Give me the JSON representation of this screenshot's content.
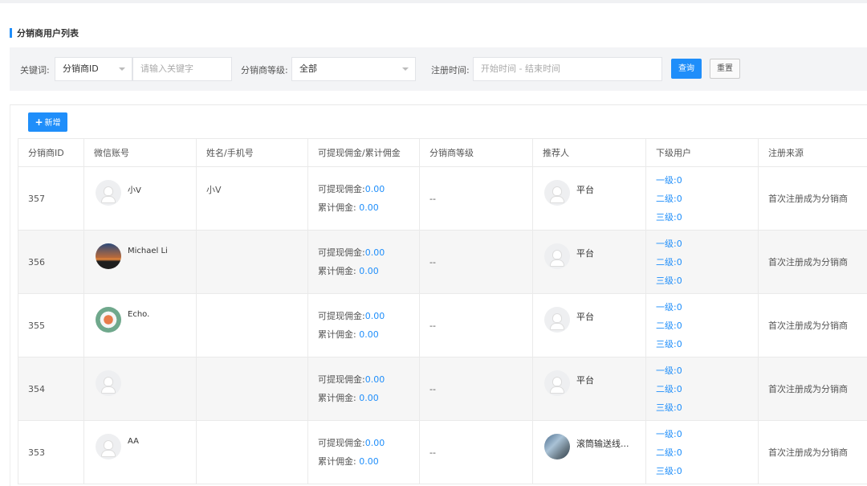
{
  "page": {
    "title": "分销商用户列表"
  },
  "filter": {
    "keyword_label": "关键词:",
    "keyword_type": "分销商ID",
    "keyword_placeholder": "请输入关键字",
    "level_label": "分销商等级:",
    "level_value": "全部",
    "time_label": "注册时间:",
    "time_placeholder": "开始时间 - 结束时间",
    "query_label": "查询",
    "reset_label": "重置"
  },
  "toolbar": {
    "add_label": "新增",
    "add_icon": "plus-icon"
  },
  "table": {
    "columns": [
      "分销商ID",
      "微信账号",
      "姓名/手机号",
      "可提现佣金/累计佣金",
      "分销商等级",
      "推荐人",
      "下级用户",
      "注册来源"
    ],
    "commission_label": "可提现佣金:",
    "total_label": "累计佣金:",
    "level1_label": "一级:",
    "level2_label": "二级:",
    "level3_label": "三级:",
    "rows": [
      {
        "id": "357",
        "wechat": "小Ⅴ",
        "avatar": "default-avatar-icon",
        "name": "小Ⅴ",
        "withdrawable": "0.00",
        "total": "0.00",
        "grade": "--",
        "referrer": "平台",
        "referrer_avatar": "default-avatar-icon",
        "l1": "0",
        "l2": "0",
        "l3": "0",
        "source": "首次注册成为分销商"
      },
      {
        "id": "356",
        "wechat": "Michael Li",
        "avatar": "sunset-photo-avatar",
        "name": "",
        "withdrawable": "0.00",
        "total": "0.00",
        "grade": "--",
        "referrer": "平台",
        "referrer_avatar": "default-avatar-icon",
        "l1": "0",
        "l2": "0",
        "l3": "0",
        "source": "首次注册成为分销商"
      },
      {
        "id": "355",
        "wechat": "Echo.",
        "avatar": "cartoon-photo-avatar",
        "name": "",
        "withdrawable": "0.00",
        "total": "0.00",
        "grade": "--",
        "referrer": "平台",
        "referrer_avatar": "default-avatar-icon",
        "l1": "0",
        "l2": "0",
        "l3": "0",
        "source": "首次注册成为分销商"
      },
      {
        "id": "354",
        "wechat": "",
        "avatar": "default-avatar-icon",
        "name": "",
        "withdrawable": "0.00",
        "total": "0.00",
        "grade": "--",
        "referrer": "平台",
        "referrer_avatar": "default-avatar-icon",
        "l1": "0",
        "l2": "0",
        "l3": "0",
        "source": "首次注册成为分销商"
      },
      {
        "id": "353",
        "wechat": "AA",
        "avatar": "default-avatar-icon",
        "name": "",
        "withdrawable": "0.00",
        "total": "0.00",
        "grade": "--",
        "referrer": "滚筒输送线...",
        "referrer_avatar": "machine-photo-avatar",
        "l1": "0",
        "l2": "0",
        "l3": "0",
        "source": "首次注册成为分销商"
      }
    ]
  },
  "colors": {
    "accent": "#1f8efa"
  }
}
